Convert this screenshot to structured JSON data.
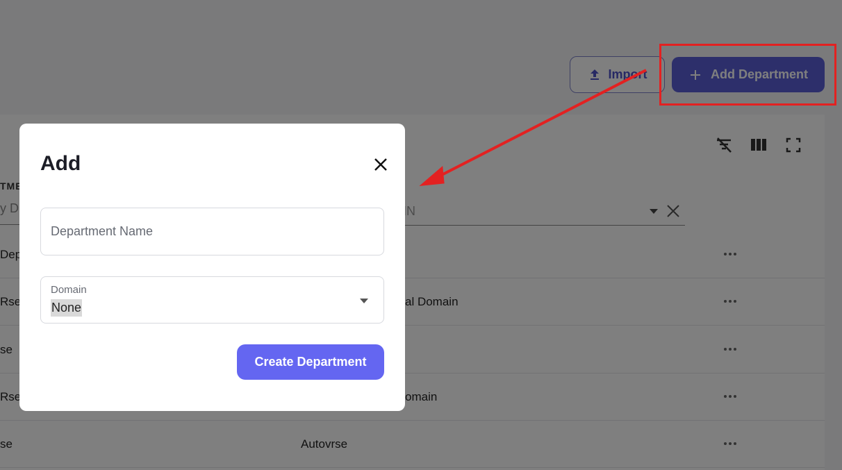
{
  "header": {
    "import_label": "Import",
    "add_department_label": "Add Department"
  },
  "table": {
    "column_left_partial": "TME",
    "filter_left_partial": "y D",
    "filter_right_partial": "IN",
    "rows": [
      {
        "col1": "Dep",
        "col2": ""
      },
      {
        "col1": "Rse",
        "col2": "al Domain"
      },
      {
        "col1": "se",
        "col2": ""
      },
      {
        "col1": "Rse",
        "col2": "omain"
      },
      {
        "col1": "se",
        "col2": "Autovrse"
      }
    ]
  },
  "dialog": {
    "title": "Add",
    "department_name_placeholder": "Department Name",
    "domain_label": "Domain",
    "domain_value": "None",
    "create_label": "Create Department"
  },
  "colors": {
    "primary": "#6466f1",
    "annotation": "#e32121"
  }
}
